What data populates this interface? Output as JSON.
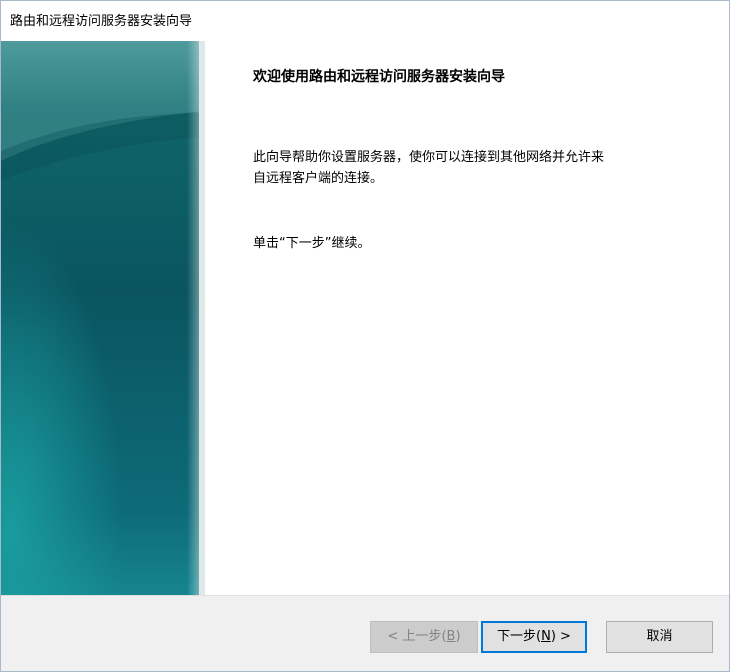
{
  "window": {
    "title": "路由和远程访问服务器安装向导"
  },
  "wizard": {
    "heading": "欢迎使用路由和远程访问服务器安装向导",
    "description_line1": "此向导帮助你设置服务器，使你可以连接到其他网络并允许来",
    "description_line2": "自远程客户端的连接。",
    "hint": "单击“下一步”继续。"
  },
  "buttons": {
    "back": {
      "prefix": "< 上一步(",
      "mnemonic": "B",
      "suffix": ")",
      "enabled": false
    },
    "next": {
      "prefix": "下一步(",
      "mnemonic": "N",
      "suffix": ") >",
      "enabled": true
    },
    "cancel": {
      "label": "取消"
    }
  },
  "colors": {
    "focus_border": "#0078d7",
    "banner_dark": "#0b4f5c",
    "banner_teal": "#14898f"
  }
}
